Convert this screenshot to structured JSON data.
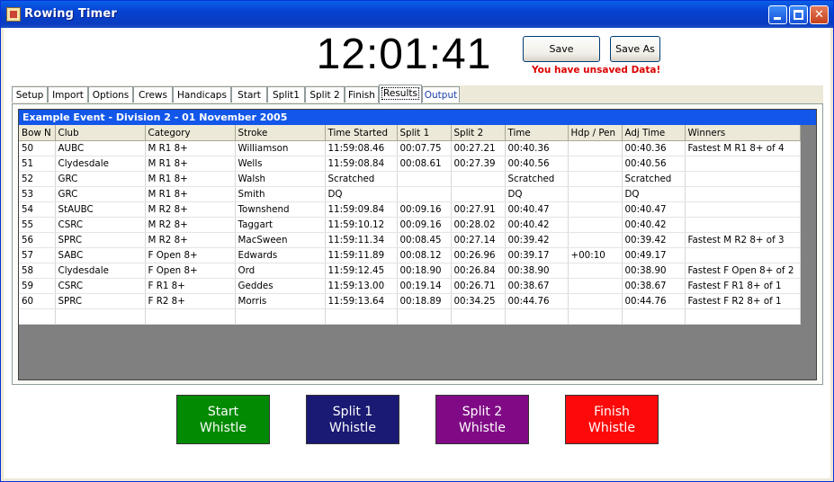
{
  "window": {
    "title": "Rowing Timer",
    "icon": "rowing-timer-app-icon"
  },
  "clock": "12:01:41",
  "toolbar": {
    "save_label": "Save",
    "save_as_label": "Save As",
    "unsaved_warning": "You have unsaved Data!"
  },
  "tabs": [
    "Setup",
    "Import",
    "Options",
    "Crews",
    "Handicaps",
    "Start",
    "Split1",
    "Split 2",
    "Finish",
    "Results",
    "Output"
  ],
  "active_tab": "Results",
  "results": {
    "caption": "Example Event - Division 2  -  01 November 2005",
    "columns": [
      "Bow N",
      "Club",
      "Category",
      "Stroke",
      "Time Started",
      "Split 1",
      "Split 2",
      "Time",
      "Hdp / Pen",
      "Adj Time",
      "Winners"
    ],
    "rows": [
      [
        "50",
        "AUBC",
        "M R1 8+",
        "Williamson",
        "11:59:08.46",
        "00:07.75",
        "00:27.21",
        "00:40.36",
        "",
        "00:40.36",
        "Fastest M R1 8+ of 4"
      ],
      [
        "51",
        "Clydesdale",
        "M R1 8+",
        "Wells",
        "11:59:08.84",
        "00:08.61",
        "00:27.39",
        "00:40.56",
        "",
        "00:40.56",
        ""
      ],
      [
        "52",
        "GRC",
        "M R1 8+",
        "Walsh",
        "Scratched",
        "",
        "",
        "Scratched",
        "",
        "Scratched",
        ""
      ],
      [
        "53",
        "GRC",
        "M R1 8+",
        "Smith",
        "DQ",
        "",
        "",
        "DQ",
        "",
        "DQ",
        ""
      ],
      [
        "54",
        "StAUBC",
        "M R2 8+",
        "Townshend",
        "11:59:09.84",
        "00:09.16",
        "00:27.91",
        "00:40.47",
        "",
        "00:40.47",
        ""
      ],
      [
        "55",
        "CSRC",
        "M R2 8+",
        "Taggart",
        "11:59:10.12",
        "00:09.16",
        "00:28.02",
        "00:40.42",
        "",
        "00:40.42",
        ""
      ],
      [
        "56",
        "SPRC",
        "M R2 8+",
        "MacSween",
        "11:59:11.34",
        "00:08.45",
        "00:27.14",
        "00:39.42",
        "",
        "00:39.42",
        "Fastest M R2 8+ of 3"
      ],
      [
        "57",
        "SABC",
        "F Open 8+",
        "Edwards",
        "11:59:11.89",
        "00:08.12",
        "00:26.96",
        "00:39.17",
        "+00:10",
        "00:49.17",
        ""
      ],
      [
        "58",
        "Clydesdale",
        "F Open 8+",
        "Ord",
        "11:59:12.45",
        "00:18.90",
        "00:26.84",
        "00:38.90",
        "",
        "00:38.90",
        "Fastest F Open 8+ of 2"
      ],
      [
        "59",
        "CSRC",
        "F R1 8+",
        "Geddes",
        "11:59:13.00",
        "00:19.14",
        "00:26.71",
        "00:38.67",
        "",
        "00:38.67",
        "Fastest F R1 8+ of 1"
      ],
      [
        "60",
        "SPRC",
        "F R2 8+",
        "Morris",
        "11:59:13.64",
        "00:18.89",
        "00:34.25",
        "00:44.76",
        "",
        "00:44.76",
        "Fastest F R2 8+ of 1"
      ],
      [
        "",
        "",
        "",
        "",
        "",
        "",
        "",
        "",
        "",
        "",
        ""
      ]
    ]
  },
  "whistles": {
    "start": "Start\nWhistle",
    "split1": "Split 1\nWhistle",
    "split2": "Split 2\nWhistle",
    "finish": "Finish\nWhistle"
  },
  "colors": {
    "start": "#038a03",
    "split1": "#1a1a74",
    "split2": "#800a86",
    "finish": "#fc0a0a",
    "caption_bar": "#1357ea",
    "warning": "#dd0000"
  }
}
